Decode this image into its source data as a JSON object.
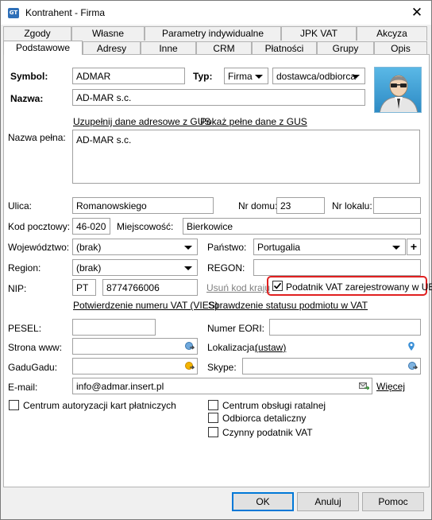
{
  "window": {
    "title": "Kontrahent - Firma",
    "icon_text": "GT",
    "close_glyph": "✕"
  },
  "tabs_row1": [
    "Zgody",
    "Własne",
    "Parametry indywidualne",
    "JPK VAT",
    "Akcyza"
  ],
  "tabs_row2": [
    "Podstawowe",
    "Adresy",
    "Inne",
    "CRM",
    "Płatności",
    "Grupy",
    "Opis"
  ],
  "active_tab": "Podstawowe",
  "header": {
    "symbol_label": "Symbol:",
    "symbol_value": "ADMAR",
    "typ_label": "Typ:",
    "typ_value": "Firma",
    "relation_value": "dostawca/odbiorca",
    "nazwa_label": "Nazwa:",
    "nazwa_value": "AD-MAR s.c."
  },
  "links": {
    "gus_fill": "Uzupełnij dane adresowe z GUS",
    "gus_show": "Pokaż pełne dane z GUS",
    "remove_country_code": "Usuń kod kraju",
    "vat_confirm": "Potwierdzenie numeru VAT (VIES)",
    "vat_status": "Sprawdzenie statusu podmiotu w VAT",
    "localization": "(ustaw)",
    "more": "Więcej"
  },
  "fields": {
    "full_name_label": "Nazwa pełna:",
    "full_name_value": "AD-MAR s.c.",
    "street_label": "Ulica:",
    "street_value": "Romanowskiego",
    "house_no_label": "Nr domu:",
    "house_no_value": "23",
    "flat_no_label": "Nr lokalu:",
    "flat_no_value": "",
    "postal_label": "Kod pocztowy:",
    "postal_value": "46-020",
    "city_label": "Miejscowość:",
    "city_value": "Bierkowice",
    "voivodeship_label": "Województwo:",
    "voivodeship_value": "(brak)",
    "country_label": "Państwo:",
    "country_value": "Portugalia",
    "region_label": "Region:",
    "region_value": "(brak)",
    "regon_label": "REGON:",
    "regon_value": "",
    "nip_label": "NIP:",
    "nip_prefix": "PT",
    "nip_value": "8774766006",
    "vat_ue_label": "Podatnik VAT zarejestrowany w UE",
    "pesel_label": "PESEL:",
    "pesel_value": "",
    "eori_label": "Numer EORI:",
    "eori_value": "",
    "www_label": "Strona www:",
    "www_value": "",
    "localization_label": "Lokalizacja:",
    "gadu_label": "GaduGadu:",
    "gadu_value": "",
    "skype_label": "Skype:",
    "skype_value": "",
    "email_label": "E-mail:",
    "email_value": "info@admar.insert.pl"
  },
  "checkboxes": {
    "vat_ue_checked": true,
    "card_center": "Centrum autoryzacji kart płatniczych",
    "installments": "Centrum obsługi ratalnej",
    "retail": "Odbiorca detaliczny",
    "active_vat": "Czynny podatnik VAT"
  },
  "buttons": {
    "ok": "OK",
    "cancel": "Anuluj",
    "help": "Pomoc",
    "add": "+"
  },
  "colors": {
    "highlight": "#e02020",
    "default_button": "#0078d7",
    "window_bg": "#f0f0f0"
  }
}
